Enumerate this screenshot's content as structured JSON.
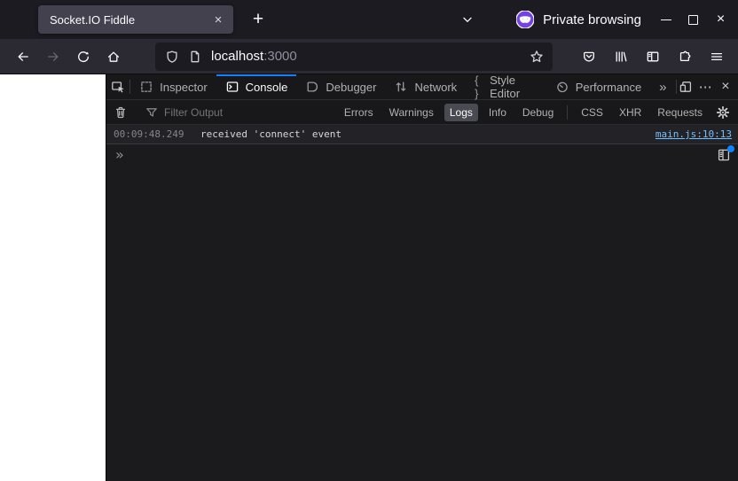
{
  "browser": {
    "tab_title": "Socket.IO Fiddle",
    "private_label": "Private browsing",
    "url_host": "localhost",
    "url_port": ":3000"
  },
  "glyphs": {
    "close": "×",
    "new_tab": "+",
    "meatball": "⋯",
    "more_tabs": "»",
    "braces": "{ }",
    "prompt": "»"
  },
  "devtools": {
    "tabs": [
      {
        "label": "Inspector"
      },
      {
        "label": "Console"
      },
      {
        "label": "Debugger"
      },
      {
        "label": "Network"
      },
      {
        "label": "Style Editor"
      },
      {
        "label": "Performance"
      }
    ],
    "active_tab": "Console",
    "filterbar": {
      "placeholder": "Filter Output",
      "levels": [
        "Errors",
        "Warnings",
        "Logs",
        "Info",
        "Debug"
      ],
      "selected_level": "Logs",
      "categories": [
        "CSS",
        "XHR",
        "Requests"
      ]
    },
    "log": {
      "timestamp": "00:09:48.249",
      "message": "received 'connect' event",
      "source_link": "main.js:10:13"
    }
  },
  "colors": {
    "accent_blue": "#0a84ff",
    "link_blue": "#75bfff",
    "private_purple": "#7543e3"
  }
}
